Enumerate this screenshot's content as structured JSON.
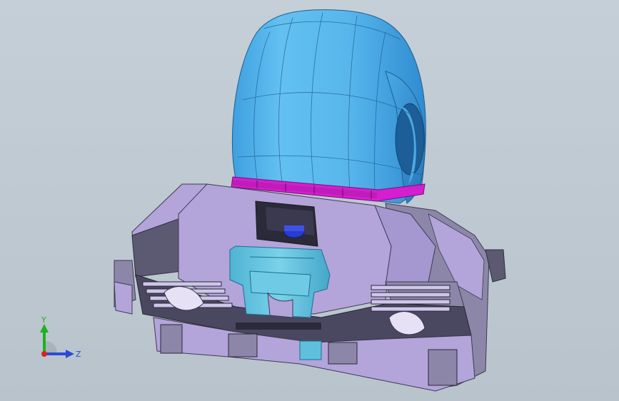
{
  "viewport": {
    "background": "#c0cad3",
    "colors": {
      "tire": "#5db8ec",
      "tire_dark": "#3a8fc7",
      "rim_band": "#d61fd0",
      "housing": "#b3a4da",
      "housing_dark": "#5c5a72",
      "housing_mid": "#8c86a8",
      "bracket": "#5ec0dc",
      "bolt": "#2a3bd0"
    }
  },
  "triad": {
    "y_label": "Y",
    "z_label": "Z",
    "y_color": "#1cb31c",
    "z_color": "#2b4bd6",
    "origin_color": "#e02020"
  }
}
